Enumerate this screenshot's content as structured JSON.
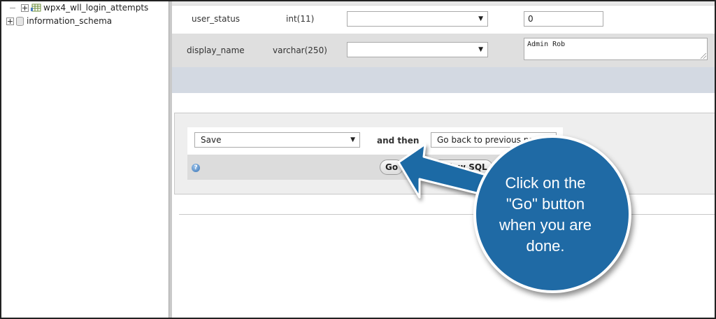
{
  "sidebar": {
    "tree": [
      {
        "label": "wpx4_wll_login_attempts",
        "type": "table"
      },
      {
        "label": "information_schema",
        "type": "database"
      }
    ]
  },
  "form": {
    "rows": [
      {
        "column": "user_status",
        "type": "int(11)",
        "function_value": "",
        "value": "0"
      },
      {
        "column": "display_name",
        "type": "varchar(250)",
        "function_value": "",
        "value": "Admin Rob"
      }
    ]
  },
  "actions": {
    "action_select": "Save",
    "and_then_label": "and then",
    "after_select": "Go back to previous page",
    "go_button": "Go",
    "preview_button": "Preview SQL",
    "help_icon": "?"
  },
  "callout": {
    "text_lines": [
      "Click on the",
      "\"Go\" button",
      "when you are",
      "done."
    ],
    "color": "#1f6aa5"
  }
}
